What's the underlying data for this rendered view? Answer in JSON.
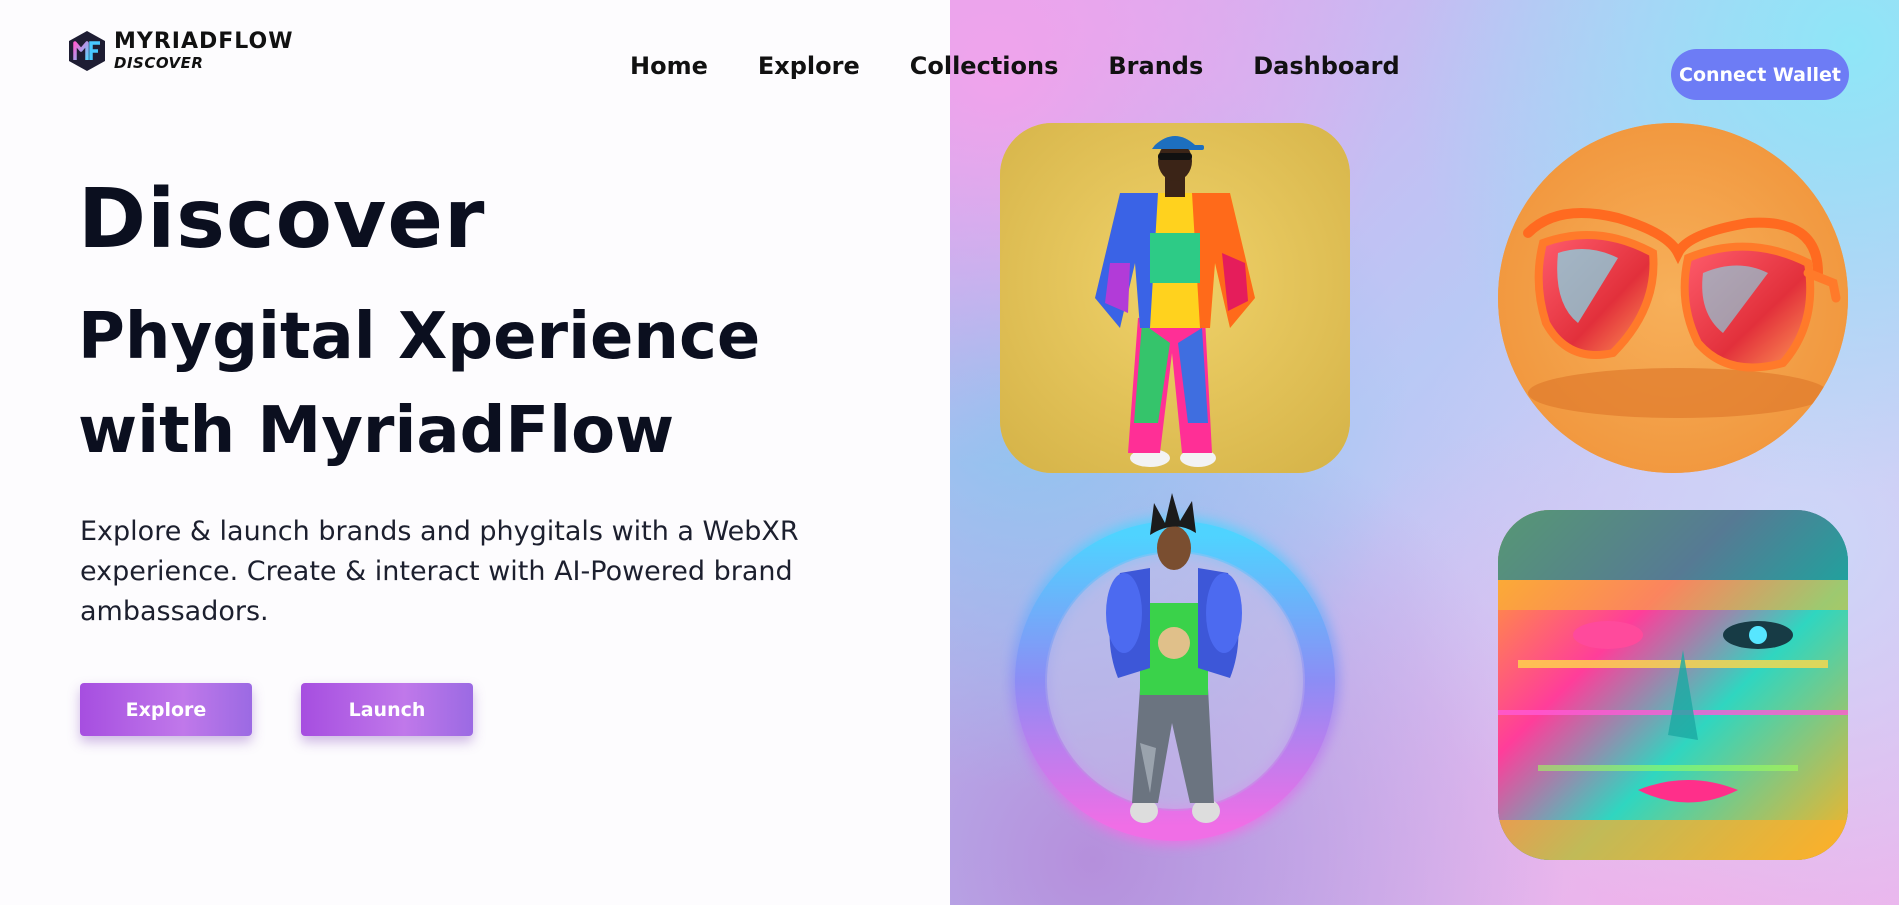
{
  "brand": {
    "name": "MYRIADFLOW",
    "sub": "DISCOVER"
  },
  "nav": {
    "items": [
      "Home",
      "Explore",
      "Collections",
      "Brands",
      "Dashboard"
    ]
  },
  "header": {
    "connect_wallet": "Connect Wallet"
  },
  "hero": {
    "title_line1": "Discover",
    "title_line2": "Phygital Xperience with MyriadFlow",
    "description": "Explore & launch brands and phygitals with a WebXR experience. Create & interact with AI-Powered brand ambassadors.",
    "explore_button": "Explore",
    "launch_button": "Launch"
  },
  "colors": {
    "accent_button": "#6d7cf5",
    "cta_purple": "#a64ee0",
    "heading": "#0b0f1f"
  }
}
